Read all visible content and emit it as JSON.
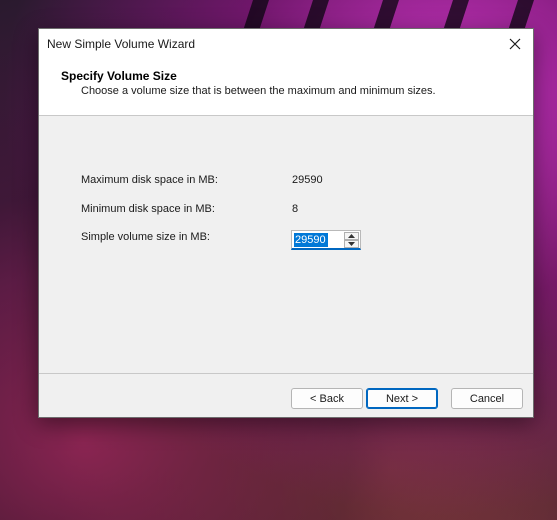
{
  "window": {
    "title": "New Simple Volume Wizard"
  },
  "header": {
    "title": "Specify Volume Size",
    "subtitle": "Choose a volume size that is between the maximum and minimum sizes."
  },
  "fields": {
    "max_label": "Maximum disk space in MB:",
    "max_value": "29590",
    "min_label": "Minimum disk space in MB:",
    "min_value": "8",
    "size_label": "Simple volume size in MB:",
    "size_value": "29590"
  },
  "buttons": {
    "back": "< Back",
    "next": "Next >",
    "cancel": "Cancel"
  },
  "icons": {
    "close": "close-icon",
    "up": "chevron-up-icon",
    "down": "chevron-down-icon"
  },
  "colors": {
    "accent": "#0067c0",
    "selection": "#0078d7",
    "dialog_bg": "#f0f0f0"
  }
}
